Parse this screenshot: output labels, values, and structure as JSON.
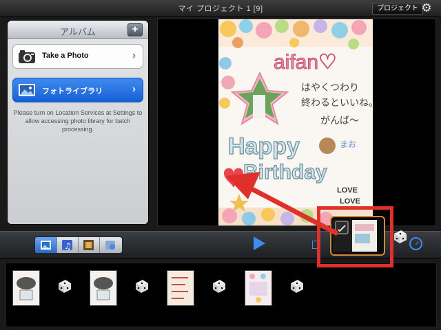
{
  "topbar": {
    "title": "マイ プロジェクト 1 [9]",
    "project_button": "プロジェクト",
    "settings_icon": "gear-icon"
  },
  "album": {
    "title": "アルバム",
    "add_label": "+",
    "take_photo": "Take a Photo",
    "photo_library": "フォトライブラリ",
    "notice": "Please turn on Location Services at Settings to allow accessing photo library for batch processing."
  },
  "card": {
    "logo": "aifan♡",
    "message_lines": [
      "はやくつわり",
      "終わるといいね。",
      "がんば〜"
    ],
    "happy": "Happy",
    "birthday": "Birthday",
    "name": "まお",
    "love": [
      "LOVE",
      "LOVE"
    ]
  },
  "toolbar": {
    "media_tabs": [
      "photos",
      "music",
      "film",
      "settings"
    ],
    "selected_tab": 0
  },
  "strip": {
    "items": [
      "photo-thumb",
      "transition-dice",
      "photo-thumb",
      "transition-dice",
      "photo-thumb",
      "transition-dice",
      "photo-thumb",
      "transition-dice"
    ]
  },
  "colors": {
    "accent": "#3d8cf0",
    "highlight_red": "#e0302b",
    "selection_orange": "#d48a30"
  }
}
